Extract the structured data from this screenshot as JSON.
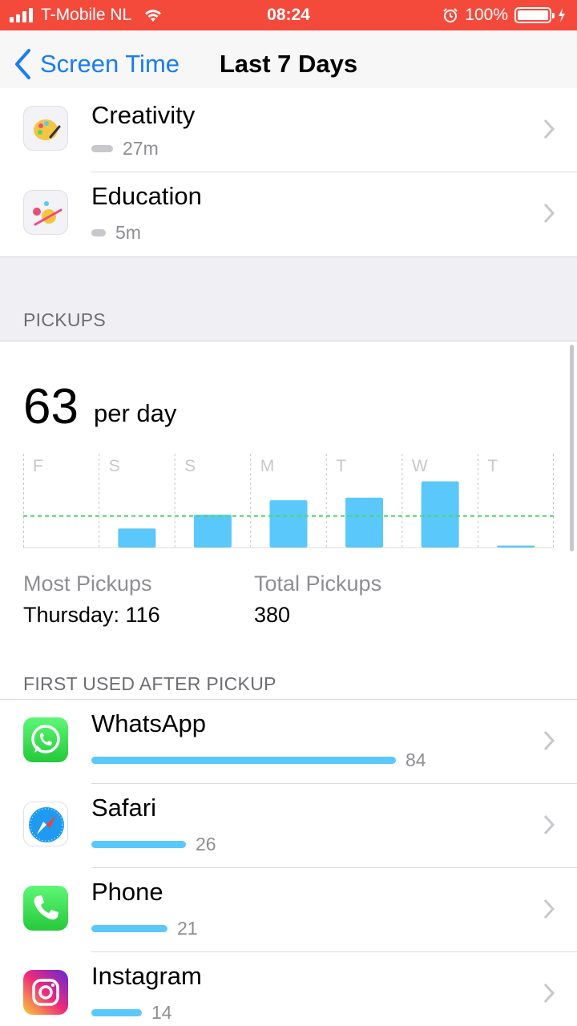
{
  "status_bar": {
    "carrier": "T-Mobile NL",
    "time": "08:24",
    "battery": "100%"
  },
  "nav": {
    "back_label": "Screen Time",
    "title": "Last 7 Days"
  },
  "categories": [
    {
      "name": "Creativity",
      "value": "27m"
    },
    {
      "name": "Education",
      "value": "5m"
    }
  ],
  "pickups": {
    "header": "PICKUPS",
    "average": "63",
    "average_unit": "per day",
    "most_label": "Most Pickups",
    "most_value": "Thursday: 116",
    "total_label": "Total Pickups",
    "total_value": "380"
  },
  "chart_data": {
    "type": "bar",
    "categories": [
      "F",
      "S",
      "S",
      "M",
      "T",
      "W",
      "T"
    ],
    "values": [
      0,
      30,
      52,
      75,
      79,
      105,
      3
    ],
    "average_line": 50,
    "ylim": [
      0,
      140
    ],
    "colors": {
      "bar": "#5ac8fa",
      "average": "#4cd964"
    }
  },
  "first_used": {
    "header": "FIRST USED AFTER PICKUP",
    "apps": [
      {
        "name": "WhatsApp",
        "value": "84",
        "icon": "whatsapp-icon"
      },
      {
        "name": "Safari",
        "value": "26",
        "icon": "safari-icon"
      },
      {
        "name": "Phone",
        "value": "21",
        "icon": "phone-icon"
      },
      {
        "name": "Instagram",
        "value": "14",
        "icon": "instagram-icon"
      }
    ]
  }
}
